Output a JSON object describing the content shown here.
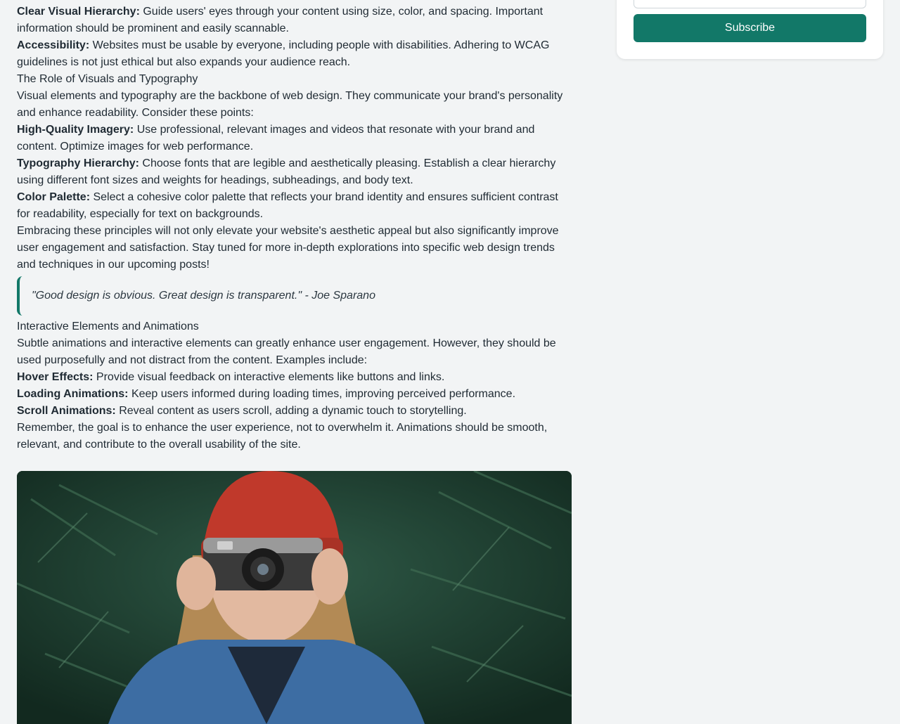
{
  "article": {
    "items": [
      {
        "label": "Clear Visual Hierarchy:",
        "text": " Guide users' eyes through your content using size, color, and spacing. Important information should be prominent and easily scannable."
      },
      {
        "label": "Accessibility:",
        "text": " Websites must be usable by everyone, including people with disabilities. Adhering to WCAG guidelines is not just ethical but also expands your audience reach."
      }
    ],
    "heading_visuals": "The Role of Visuals and Typography",
    "intro_visuals": "Visual elements and typography are the backbone of web design. They communicate your brand's personality and enhance readability. Consider these points:",
    "visual_points": [
      {
        "label": "High-Quality Imagery:",
        "text": " Use professional, relevant images and videos that resonate with your brand and content. Optimize images for web performance."
      },
      {
        "label": "Typography Hierarchy:",
        "text": " Choose fonts that are legible and aesthetically pleasing. Establish a clear hierarchy using different font sizes and weights for headings, subheadings, and body text."
      },
      {
        "label": "Color Palette:",
        "text": " Select a cohesive color palette that reflects your brand identity and ensures sufficient contrast for readability, especially for text on backgrounds."
      }
    ],
    "closing_visuals": "Embracing these principles will not only elevate your website's aesthetic appeal but also significantly improve user engagement and satisfaction. Stay tuned for more in-depth explorations into specific web design trends and techniques in our upcoming posts!",
    "quote": "\"Good design is obvious. Great design is transparent.\" - Joe Sparano",
    "heading_interactive": "Interactive Elements and Animations",
    "intro_interactive": "Subtle animations and interactive elements can greatly enhance user engagement. However, they should be used purposefully and not distract from the content. Examples include:",
    "interactive_points": [
      {
        "label": "Hover Effects:",
        "text": " Provide visual feedback on interactive elements like buttons and links."
      },
      {
        "label": "Loading Animations:",
        "text": " Keep users informed during loading times, improving perceived performance."
      },
      {
        "label": "Scroll Animations:",
        "text": " Reveal content as users scroll, adding a dynamic touch to storytelling."
      }
    ],
    "closing_interactive": "Remember, the goal is to enhance the user experience, not to overwhelm it. Animations should be smooth, relevant, and contribute to the overall usability of the site."
  },
  "sidebar": {
    "subscribe_label": "Subscribe"
  },
  "colors": {
    "accent": "#127868",
    "page_bg": "#f2f4f5",
    "text": "#1f2a33"
  },
  "icons": {
    "photo": "woman-with-camera-photo"
  }
}
